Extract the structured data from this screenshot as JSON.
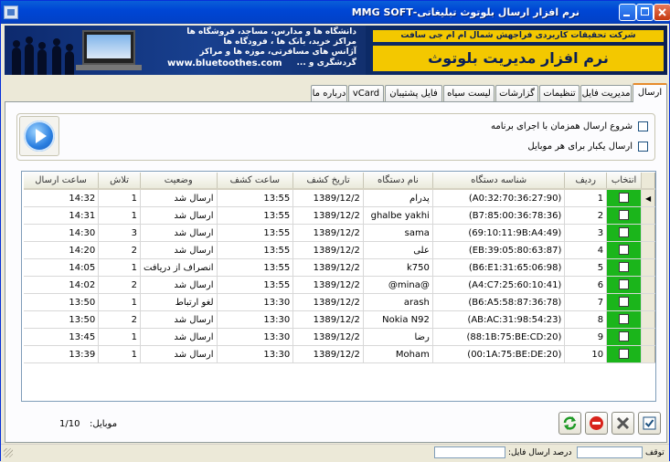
{
  "window": {
    "title": "نرم افزار ارسال بلوتوث تبلیغاتی-MMG SOFT"
  },
  "banner": {
    "left_line1": "دانشگاه ها و مدارس، مساجد، فروشگاه ها",
    "left_line2": "مراکز خرید، بانک ها ، فرودگاه ها",
    "left_line3": "آژانس های مسافرتی، موزه ها و مراکز",
    "left_line4": "گردشگری و ...",
    "url": "www.bluetoothes.com",
    "company": "شرکت تحقیقات کاربردی فراجهش شمال  ام ام جی سافت",
    "product": "نرم افزار مدیریت بلوتوث"
  },
  "tabs": [
    {
      "label": "ارسال",
      "active": true
    },
    {
      "label": "مدیریت فایل",
      "active": false
    },
    {
      "label": "تنظیمات",
      "active": false
    },
    {
      "label": "گزارشات",
      "active": false
    },
    {
      "label": "لیست سیاه",
      "active": false
    },
    {
      "label": "فایل پشتیبان",
      "active": false
    },
    {
      "label": "vCard",
      "active": false
    },
    {
      "label": "درباره ما",
      "active": false
    }
  ],
  "options": {
    "start_with_app": "شروع ارسال همزمان با اجرای برنامه",
    "send_once": "ارسال یکبار برای هر موبایل"
  },
  "grid": {
    "headers": {
      "select": "انتخاب",
      "row": "ردیف",
      "device_id": "شناسه دستگاه",
      "device_name": "نام دستگاه",
      "discover_date": "تاریخ کشف",
      "discover_time": "ساعت کشف",
      "status": "وضعیت",
      "attempts": "تلاش",
      "send_time": "ساعت ارسال"
    },
    "rows": [
      {
        "row": "1",
        "device_id": "(A0:32:70:36:27:90)",
        "device_name": "پدرام",
        "discover_date": "1389/12/2",
        "discover_time": "13:55",
        "status": "ارسال شد",
        "attempts": "1",
        "send_time": "14:32"
      },
      {
        "row": "2",
        "device_id": "(B7:85:00:36:78:36)",
        "device_name": "ghalbe yakhi",
        "discover_date": "1389/12/2",
        "discover_time": "13:55",
        "status": "ارسال شد",
        "attempts": "1",
        "send_time": "14:31"
      },
      {
        "row": "3",
        "device_id": "(69:10:11:9B:A4:49)",
        "device_name": "sama",
        "discover_date": "1389/12/2",
        "discover_time": "13:55",
        "status": "ارسال شد",
        "attempts": "3",
        "send_time": "14:30"
      },
      {
        "row": "4",
        "device_id": "(EB:39:05:80:63:87)",
        "device_name": "علی",
        "discover_date": "1389/12/2",
        "discover_time": "13:55",
        "status": "ارسال شد",
        "attempts": "2",
        "send_time": "14:20"
      },
      {
        "row": "5",
        "device_id": "(B6:E1:31:65:06:98)",
        "device_name": "k750",
        "discover_date": "1389/12/2",
        "discover_time": "13:55",
        "status": "انصراف از دریافت",
        "attempts": "1",
        "send_time": "14:05"
      },
      {
        "row": "6",
        "device_id": "(A4:C7:25:60:10:41)",
        "device_name": "@mina@",
        "discover_date": "1389/12/2",
        "discover_time": "13:55",
        "status": "ارسال شد",
        "attempts": "2",
        "send_time": "14:02"
      },
      {
        "row": "7",
        "device_id": "(B6:A5:58:87:36:78)",
        "device_name": "arash",
        "discover_date": "1389/12/2",
        "discover_time": "13:30",
        "status": "لغو ارتباط",
        "attempts": "1",
        "send_time": "13:50"
      },
      {
        "row": "8",
        "device_id": "(AB:AC:31:98:54:23)",
        "device_name": "Nokia N92",
        "discover_date": "1389/12/2",
        "discover_time": "13:30",
        "status": "ارسال شد",
        "attempts": "2",
        "send_time": "13:50"
      },
      {
        "row": "9",
        "device_id": "(88:1B:75:BE:CD:20)",
        "device_name": "رضا",
        "discover_date": "1389/12/2",
        "discover_time": "13:30",
        "status": "ارسال شد",
        "attempts": "1",
        "send_time": "13:45"
      },
      {
        "row": "10",
        "device_id": "(00:1A:75:BE:DE:20)",
        "device_name": "Moham",
        "discover_date": "1389/12/2",
        "discover_time": "13:30",
        "status": "ارسال شد",
        "attempts": "1",
        "send_time": "13:39"
      }
    ]
  },
  "footer": {
    "mobile_label": "موبایل:",
    "mobile_value": "1/10"
  },
  "statusbar": {
    "stop_label": "توقف",
    "percent_label": "درصد ارسال فایل:"
  },
  "colors": {
    "titlebar": "#0046d5",
    "select_cell": "#1bb51b",
    "active_tab_accent": "#e68b2c"
  },
  "icons": {
    "start": "play-icon",
    "refresh": "refresh-icon",
    "stop": "stop-icon",
    "cancel": "x-icon",
    "select_all": "check-icon"
  }
}
